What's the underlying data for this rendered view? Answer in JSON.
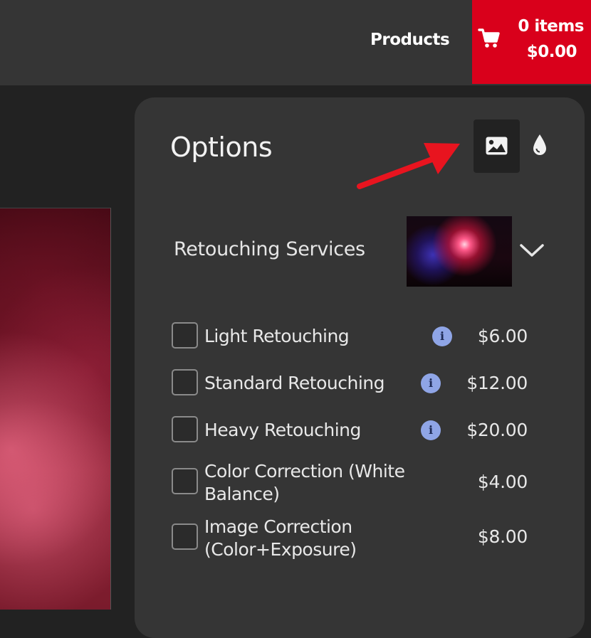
{
  "nav": {
    "products_label": "Products"
  },
  "cart": {
    "count_label": "0 items",
    "total_label": "$0.00",
    "icon": "shopping-cart-icon",
    "color": "#d9001b"
  },
  "panel": {
    "title": "Options",
    "view_buttons": [
      {
        "icon": "image-icon",
        "active": true
      },
      {
        "icon": "droplet-icon",
        "active": false
      }
    ],
    "section": {
      "title": "Retouching Services",
      "expanded": true,
      "options": [
        {
          "label": "Light Retouching",
          "price": "$6.00",
          "has_info": true,
          "checked": false
        },
        {
          "label": "Standard Retouching",
          "price": "$12.00",
          "has_info": true,
          "checked": false
        },
        {
          "label": "Heavy Retouching",
          "price": "$20.00",
          "has_info": true,
          "checked": false
        },
        {
          "label": "Color Correction (White Balance)",
          "price": "$4.00",
          "has_info": false,
          "checked": false
        },
        {
          "label": "Image Correction (Color+Exposure)",
          "price": "$8.00",
          "has_info": false,
          "checked": false
        }
      ]
    }
  },
  "annotation": {
    "icon": "red-arrow-icon",
    "color": "#e8141f"
  },
  "info_glyph": "i"
}
